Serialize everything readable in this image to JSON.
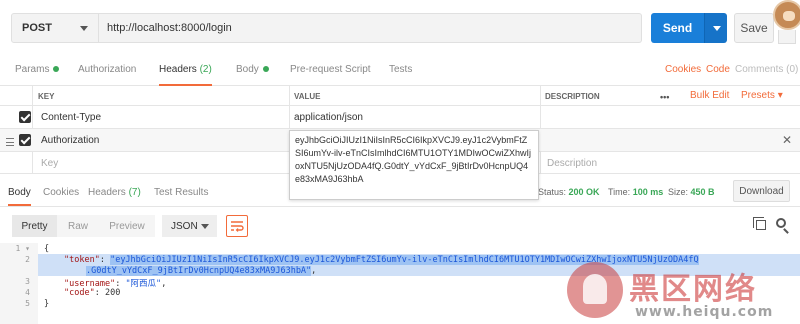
{
  "request": {
    "method": "POST",
    "url": "http://localhost:8000/login",
    "send_label": "Send",
    "save_label": "Save"
  },
  "req_tabs": {
    "params": "Params",
    "authorization": "Authorization",
    "headers": "Headers",
    "headers_count": "(2)",
    "body": "Body",
    "prerequest": "Pre-request Script",
    "tests": "Tests",
    "cookies": "Cookies",
    "code": "Code",
    "comments": "Comments (0)"
  },
  "headers_table": {
    "col_key": "KEY",
    "col_value": "VALUE",
    "col_description": "DESCRIPTION",
    "more": "•••",
    "bulk_edit": "Bulk Edit",
    "presets": "Presets",
    "rows": [
      {
        "key": "Content-Type",
        "value": "application/json"
      },
      {
        "key": "Authorization",
        "value": "eyJhbGciOiJIUzI1NiIsInR5cCI6IkpXVCJ9.eyJ1c2VybmFtZSI..."
      }
    ],
    "key_placeholder": "Key",
    "description_placeholder": "Description",
    "tooltip_value": "eyJhbGciOiJIUzI1NiIsInR5cCI6IkpXVCJ9.eyJ1c2VybmFtZSI6umYv-ilv-eTnCIsImlhdCI6MTU1OTY1MDIwOCwiZXhwIjoxNTU5NjUzODA4fQ.G0dtY_vYdCxF_9jBtIrDv0HcnpUQ4e83xMA9J63hbA"
  },
  "resp_tabs": {
    "body": "Body",
    "cookies": "Cookies",
    "headers": "Headers",
    "headers_count": "(7)",
    "test_results": "Test Results"
  },
  "response_meta": {
    "status_label": "Status:",
    "status_value": "200 OK",
    "time_label": "Time:",
    "time_value": "100 ms",
    "size_label": "Size:",
    "size_value": "450 B",
    "download_label": "Download"
  },
  "resp_toolbar": {
    "pretty": "Pretty",
    "raw": "Raw",
    "preview": "Preview",
    "format": "JSON"
  },
  "code": {
    "line1": "{",
    "token_key": "\"token\"",
    "token_val_1": "\"eyJhbGciOiJIUzI1NiIsInR5cCI6IkpXVCJ9.eyJ1c2VybmFtZSI6umYv-ilv-eTnCIsImlhdCI6MTU1OTY1MDIwOCwiZXhwIjoxNTU5NjUzODA4fQ",
    "token_val_2": ".G0dtY_vYdCxF_9jBtIrDv0HcnpUQ4e83xMA9J63hbA\"",
    "username_key": "\"username\"",
    "username_val": "\"阿西瓜\"",
    "code_key": "\"code\"",
    "code_val": "200",
    "line_last": "}"
  },
  "watermark": {
    "text": "黑区网络",
    "url": "www.heiqu.com"
  }
}
